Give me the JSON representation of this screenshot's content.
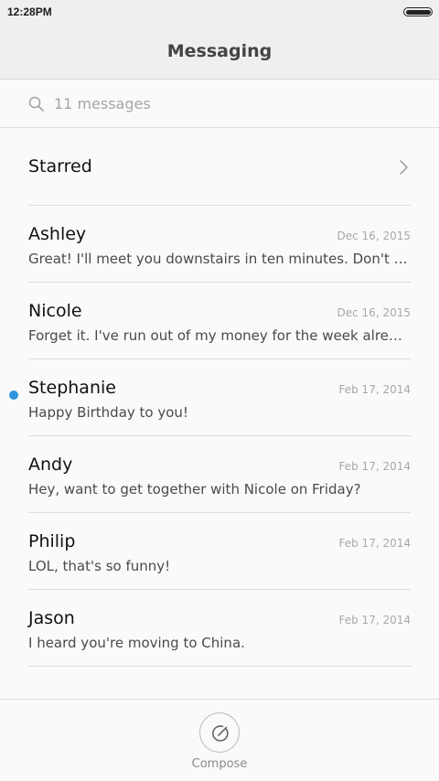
{
  "status_bar": {
    "time": "12:28PM"
  },
  "header": {
    "title": "Messaging"
  },
  "search": {
    "placeholder": "11 messages",
    "icon": "search-icon"
  },
  "starred": {
    "label": "Starred",
    "icon": "chevron-right-icon"
  },
  "threads": [
    {
      "name": "Ashley",
      "date": "Dec 16, 2015",
      "preview": "Great! I'll meet you downstairs in ten minutes. Don't forge…",
      "unread": false
    },
    {
      "name": "Nicole",
      "date": "Dec 16, 2015",
      "preview": "Forget it. I've run out of my money for the week already.",
      "unread": false
    },
    {
      "name": "Stephanie",
      "date": "Feb 17, 2014",
      "preview": "Happy Birthday to you!",
      "unread": true
    },
    {
      "name": "Andy",
      "date": "Feb 17, 2014",
      "preview": "Hey, want to get together with Nicole on Friday?",
      "unread": false
    },
    {
      "name": "Philip",
      "date": "Feb 17, 2014",
      "preview": "LOL, that's so funny!",
      "unread": false
    },
    {
      "name": "Jason",
      "date": "Feb 17, 2014",
      "preview": "I heard you're moving to China.",
      "unread": false
    }
  ],
  "compose": {
    "label": "Compose",
    "icon": "compose-icon"
  },
  "colors": {
    "unread_accent": "#2f93dd",
    "header_bg": "#efefef",
    "background": "#fafafa"
  }
}
